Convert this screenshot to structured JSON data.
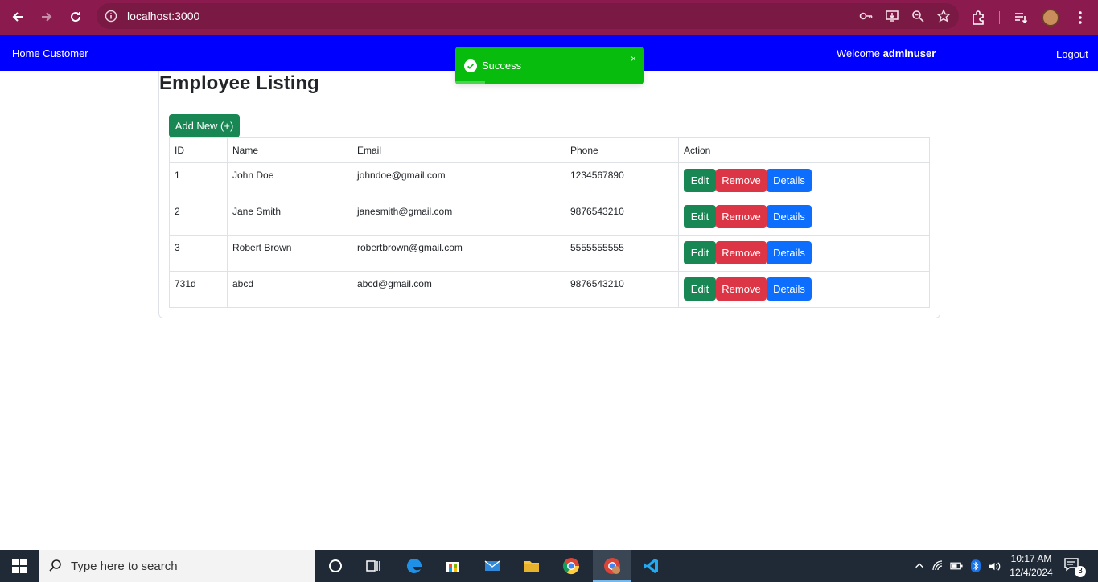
{
  "browser": {
    "url": "localhost:3000"
  },
  "app_nav": {
    "home_link": "Home Customer",
    "welcome_prefix": "Welcome",
    "username": "adminuser",
    "logout": "Logout"
  },
  "toast": {
    "message": "Success",
    "close": "×",
    "progress_percent": 16
  },
  "page": {
    "title": "Employee Listing",
    "add_button": "Add New (+)"
  },
  "table": {
    "headers": [
      "ID",
      "Name",
      "Email",
      "Phone",
      "Action"
    ],
    "rows": [
      {
        "id": "1",
        "name": "John Doe",
        "email": "johndoe@gmail.com",
        "phone": "1234567890"
      },
      {
        "id": "2",
        "name": "Jane Smith",
        "email": "janesmith@gmail.com",
        "phone": "9876543210"
      },
      {
        "id": "3",
        "name": "Robert Brown",
        "email": "robertbrown@gmail.com",
        "phone": "5555555555"
      },
      {
        "id": "731d",
        "name": "abcd",
        "email": "abcd@gmail.com",
        "phone": "9876543210"
      }
    ],
    "actions": {
      "edit": "Edit",
      "remove": "Remove",
      "details": "Details"
    }
  },
  "taskbar": {
    "search_placeholder": "Type here to search",
    "time": "10:17 AM",
    "date": "12/4/2024",
    "notification_count": "3"
  },
  "colors": {
    "browser_bar": "#8b1a4e",
    "app_nav": "#0000ff",
    "toast_success": "#07bc0c",
    "btn_success": "#198754",
    "btn_danger": "#dc3545",
    "btn_primary": "#0d6efd"
  }
}
